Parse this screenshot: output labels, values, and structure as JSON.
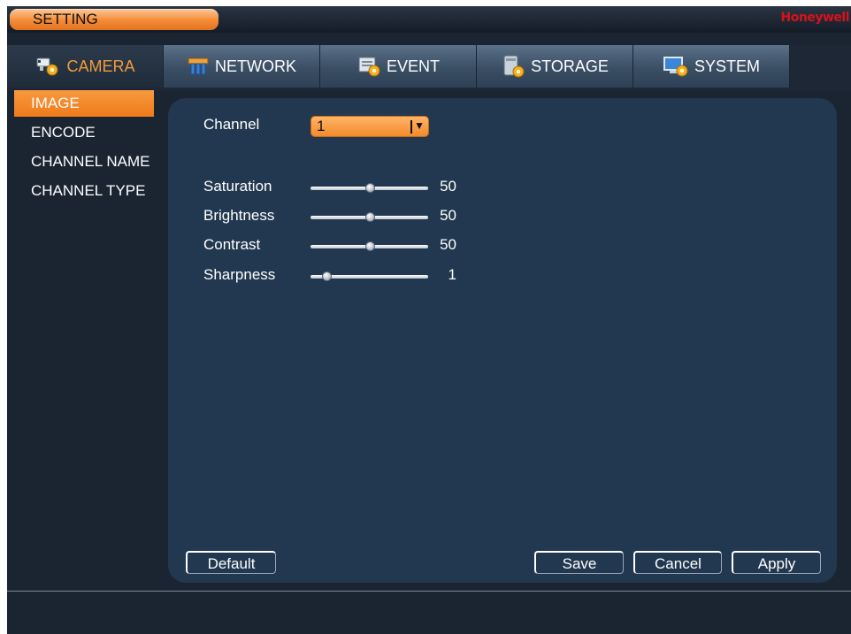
{
  "titlebar": {
    "title": "SETTING",
    "brand": "Honeywell"
  },
  "tabs": [
    {
      "label": "CAMERA",
      "icon": "camera-gear-icon",
      "active": true
    },
    {
      "label": "NETWORK",
      "icon": "network-icon",
      "active": false
    },
    {
      "label": "EVENT",
      "icon": "event-icon",
      "active": false
    },
    {
      "label": "STORAGE",
      "icon": "storage-icon",
      "active": false
    },
    {
      "label": "SYSTEM",
      "icon": "system-monitor-icon",
      "active": false
    }
  ],
  "sidebar": {
    "items": [
      {
        "label": "IMAGE",
        "active": true
      },
      {
        "label": "ENCODE",
        "active": false
      },
      {
        "label": "CHANNEL NAME",
        "active": false
      },
      {
        "label": "CHANNEL TYPE",
        "active": false
      }
    ]
  },
  "form": {
    "channel_label": "Channel",
    "channel_value": "1",
    "sliders": [
      {
        "label": "Saturation",
        "value": "50",
        "min": 0,
        "max": 100
      },
      {
        "label": "Brightness",
        "value": "50",
        "min": 0,
        "max": 100
      },
      {
        "label": "Contrast",
        "value": "50",
        "min": 0,
        "max": 100
      },
      {
        "label": "Sharpness",
        "value": "1",
        "min": 0,
        "max": 15
      }
    ]
  },
  "buttons": {
    "default": "Default",
    "save": "Save",
    "cancel": "Cancel",
    "apply": "Apply"
  },
  "colors": {
    "accent": "#f48a28",
    "brand": "#d8121a",
    "panel": "#223850",
    "background": "#1b2532"
  }
}
